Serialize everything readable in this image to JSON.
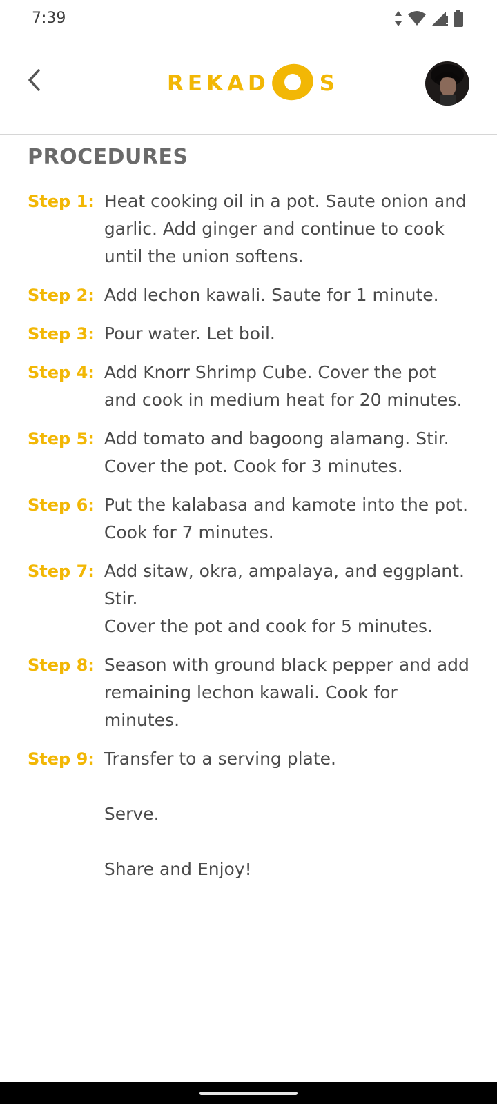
{
  "status_bar": {
    "time": "7:39",
    "icons": [
      "data-arrows-icon",
      "wifi-icon",
      "signal-icon",
      "battery-icon"
    ]
  },
  "header": {
    "back_icon": "chevron-left-icon",
    "logo_text_left": "REKAD",
    "logo_text_right": "S",
    "avatar": "user-avatar"
  },
  "procedures": {
    "title": "PROCEDURES",
    "steps": [
      {
        "label": "Step 1:",
        "text": "Heat cooking oil in a pot. Saute onion and garlic. Add ginger and continue to cook until the union softens."
      },
      {
        "label": "Step 2:",
        "text": "Add lechon kawali. Saute for 1 minute."
      },
      {
        "label": "Step 3:",
        "text": "Pour water. Let boil."
      },
      {
        "label": "Step 4:",
        "text": "Add Knorr Shrimp Cube. Cover the pot and cook in medium heat for 20 minutes."
      },
      {
        "label": "Step 5:",
        "text": "Add tomato and bagoong alamang. Stir.\nCover the pot. Cook for 3 minutes."
      },
      {
        "label": "Step 6:",
        "text": "Put the kalabasa and kamote into the pot. Cook for 7 minutes."
      },
      {
        "label": "Step 7:",
        "text": "Add sitaw, okra, ampalaya, and eggplant.\nStir.\nCover the pot and cook for 5 minutes."
      },
      {
        "label": "Step 8:",
        "text": "Season with ground black pepper and add remaining lechon kawali. Cook for minutes."
      },
      {
        "label": "Step 9:",
        "text": "Transfer to a serving plate.\n\nServe.\n\nShare and Enjoy!"
      }
    ]
  },
  "colors": {
    "accent": "#f2b705",
    "title": "#6a6a6a",
    "body_text": "#4a4a4a",
    "divider": "#d6d6d6"
  }
}
